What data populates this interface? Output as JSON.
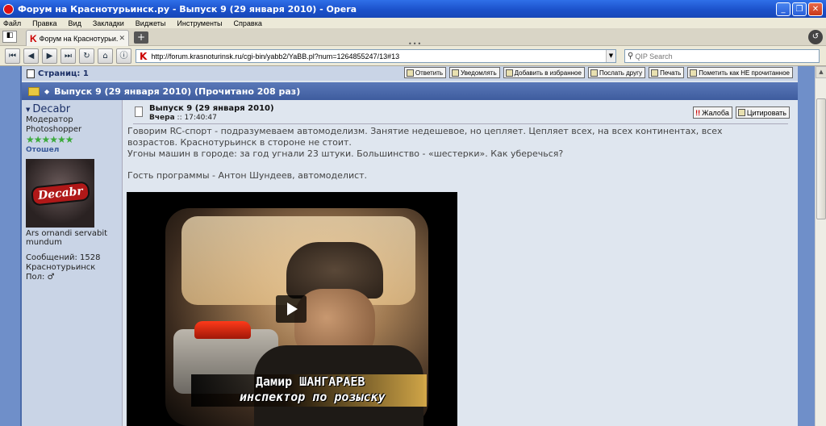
{
  "window": {
    "title": "Форум на Краснотурьинск.ру - Выпуск 9 (29 января 2010) - Opera"
  },
  "menu": [
    "Файл",
    "Правка",
    "Вид",
    "Закладки",
    "Виджеты",
    "Инструменты",
    "Справка"
  ],
  "tab": {
    "label": "Форум на Краснотурьи...",
    "close": "✕"
  },
  "address": {
    "url": "http://forum.krasnoturinsk.ru/cgi-bin/yabb2/YaBB.pl?num=1264855247/13#13",
    "search_placeholder": "QIP Search"
  },
  "forum": {
    "pages_label": "Страниц: 1",
    "actions": [
      "Ответить",
      "Уведомлять",
      "Добавить в избранное",
      "Послать другу",
      "Печать",
      "Пометить как НЕ прочитанное"
    ],
    "thread_title": "Выпуск 9 (29 января 2010) (Прочитано 208 раз)"
  },
  "user": {
    "name": "Decabr",
    "role1": "Модератор",
    "role2": "Photoshopper",
    "stars": "★★★★★★",
    "status": "Отошел",
    "avatar_text": "Decabr",
    "motto": "Ars ornandi servabit mundum",
    "posts": "Сообщений: 1528",
    "city": "Краснотурьинск",
    "gender": "Пол: ♂"
  },
  "post": {
    "title": "Выпуск 9 (29 января 2010)",
    "date_day": "Вчера",
    "date_time": " :: 17:40:47",
    "btn_complaint": "Жалоба",
    "btn_quote": "Цитировать",
    "line1": "Говорим RC-спорт - подразумеваем автомоделизм. Занятие недешевое, но цепляет. Цепляет всех, на всех континентах, всех",
    "line2": "возрастов. Краснотурьинск в стороне не стоит.",
    "line3": "Угоны машин в городе: за год угнали 23 штуки. Большинство - «шестерки». Как уберечься?",
    "line4": "Гость программы - Антон Шундеев, автомоделист.",
    "video_caption1": "Дамир ШАНГАРАЕВ",
    "video_caption2": "инспектор по розыску"
  }
}
